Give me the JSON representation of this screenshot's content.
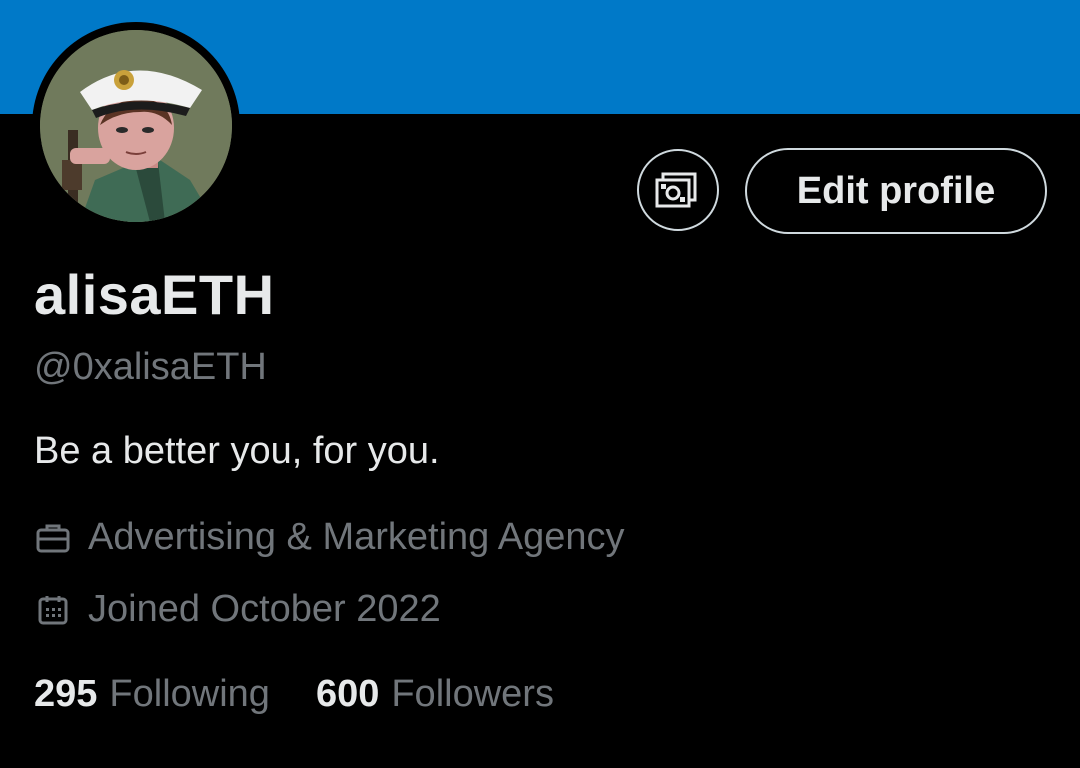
{
  "profile": {
    "display_name": "alisaETH",
    "handle": "@0xalisaETH",
    "bio": "Be a better you, for you.",
    "category": "Advertising & Marketing Agency",
    "joined": "Joined October 2022"
  },
  "actions": {
    "tip_icon": "money-icon",
    "edit_profile_label": "Edit profile"
  },
  "stats": {
    "following_count": "295",
    "following_label": "Following",
    "followers_count": "600",
    "followers_label": "Followers"
  },
  "icons": {
    "category": "briefcase-icon",
    "joined": "calendar-icon"
  },
  "colors": {
    "banner": "#0079c8",
    "background": "#000000",
    "primary_text": "#e7e9ea",
    "secondary_text": "#71767b",
    "button_border": "#cfd9de"
  }
}
